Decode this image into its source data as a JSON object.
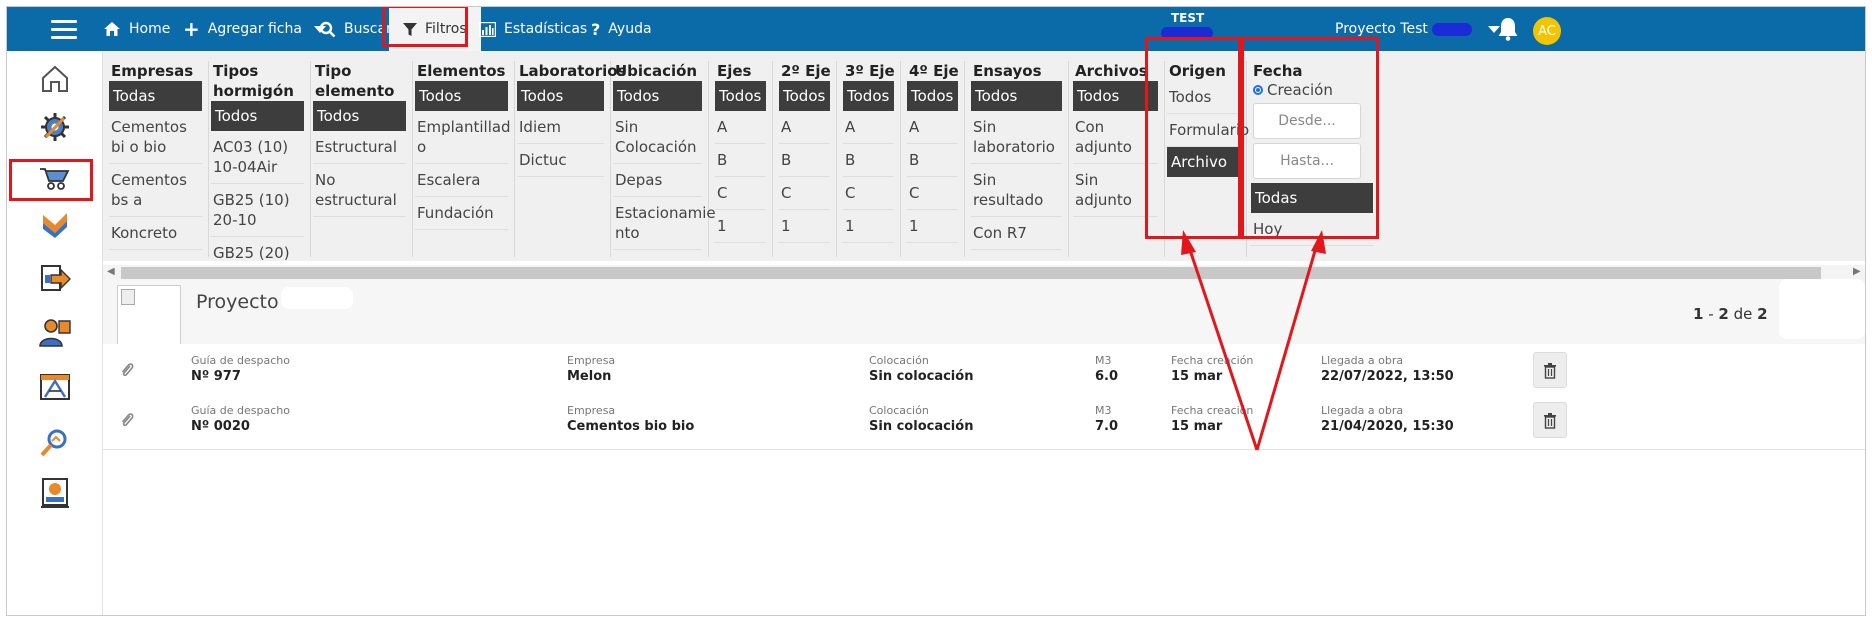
{
  "topbar": {
    "home": "Home",
    "add": "Agregar ficha",
    "search": "Buscar",
    "filters": "Filtros",
    "stats": "Estadísticas",
    "help": "Ayuda",
    "project_label": "TEST",
    "project_selector": "Proyecto Test",
    "avatar": "AC"
  },
  "filters": {
    "empresas": {
      "title": "Empresas",
      "options": [
        "Todas",
        "Cementos bi o bio",
        "Cementos bs a",
        "Koncreto"
      ]
    },
    "tipos_hormigon": {
      "title": "Tipos hormigón",
      "options": [
        "Todos",
        "AC03 (10) 10-04Air",
        "GB25 (10) 20-10",
        "GB25 (20)"
      ]
    },
    "tipo_elemento": {
      "title": "Tipo elemento",
      "options": [
        "Todos",
        "Estructural",
        "No estructural"
      ]
    },
    "elementos": {
      "title": "Elementos",
      "options": [
        "Todos",
        "Emplantillad o",
        "Escalera",
        "Fundación"
      ]
    },
    "laboratorios": {
      "title": "Laboratorios",
      "options": [
        "Todos",
        "Idiem",
        "Dictuc"
      ]
    },
    "ubicacion": {
      "title": "Ubicación",
      "options": [
        "Todos",
        "Sin Colocación",
        "Depas",
        "Estacionamie nto"
      ]
    },
    "ejes": {
      "title": "Ejes",
      "options": [
        "Todos",
        "A",
        "B",
        "C",
        "1"
      ]
    },
    "eje2": {
      "title": "2º Eje",
      "options": [
        "Todos",
        "A",
        "B",
        "C",
        "1"
      ]
    },
    "eje3": {
      "title": "3º Eje",
      "options": [
        "Todos",
        "A",
        "B",
        "C",
        "1"
      ]
    },
    "eje4": {
      "title": "4º Eje",
      "options": [
        "Todos",
        "A",
        "B",
        "C",
        "1"
      ]
    },
    "ensayos": {
      "title": "Ensayos",
      "options": [
        "Todos",
        "Sin laboratorio",
        "Sin resultado",
        "Con R7"
      ]
    },
    "archivos": {
      "title": "Archivos",
      "options": [
        "Todos",
        "Con adjunto",
        "Sin adjunto"
      ]
    },
    "origen": {
      "title": "Origen",
      "options": [
        "Todos",
        "Formulario",
        "Archivo"
      ]
    },
    "fecha": {
      "title": "Fecha",
      "radio": "Creación",
      "from": "Desde...",
      "to": "Hasta...",
      "options": [
        "Todas",
        "Hoy"
      ]
    }
  },
  "project": {
    "title": "Proyecto Test",
    "paging": {
      "from": "1",
      "sep": " - ",
      "to": "2",
      "of": " de ",
      "total": "2"
    }
  },
  "rows": [
    {
      "guia_label": "Guía de despacho",
      "guia": "Nº 977",
      "empresa_label": "Empresa",
      "empresa": "Melon",
      "col_label": "Colocación",
      "col": "Sin colocación",
      "m3_label": "M3",
      "m3": "6.0",
      "fc_label": "Fecha creación",
      "fc": "15 mar",
      "ll_label": "Llegada a obra",
      "ll": "22/07/2022, 13:50"
    },
    {
      "guia_label": "Guía de despacho",
      "guia": "Nº 0020",
      "empresa_label": "Empresa",
      "empresa": "Cementos bio bio",
      "col_label": "Colocación",
      "col": "Sin colocación",
      "m3_label": "M3",
      "m3": "7.0",
      "fc_label": "Fecha creación",
      "fc": "15 mar",
      "ll_label": "Llegada a obra",
      "ll": "21/04/2020, 15:30"
    }
  ],
  "colors": {
    "topbar": "#0b6aa8",
    "selected_option": "#3d3d3d",
    "highlight": "#e3171b",
    "avatar": "#f2c500"
  }
}
